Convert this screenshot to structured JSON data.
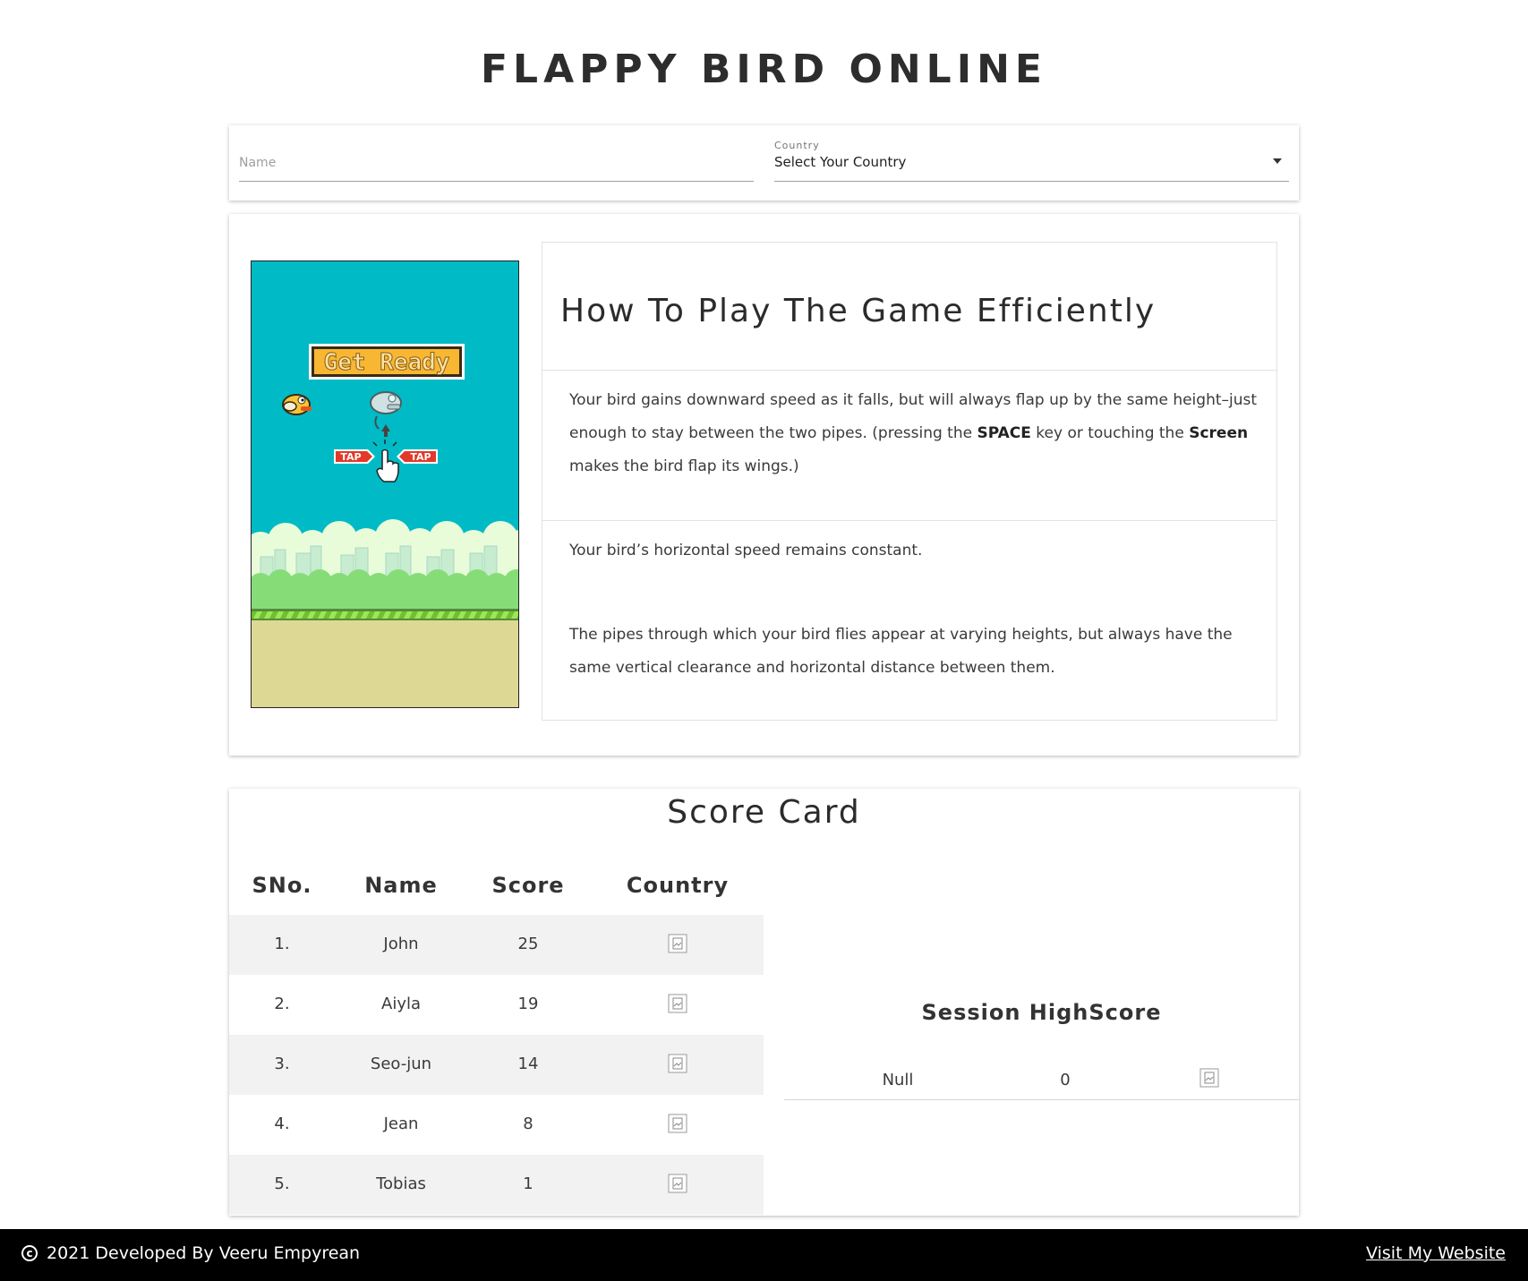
{
  "page": {
    "title": "FLAPPY BIRD ONLINE"
  },
  "form": {
    "name_placeholder": "Name",
    "country_label": "Country",
    "country_value": "Select Your Country"
  },
  "game": {
    "get_ready_text": "Get Ready",
    "tap_left": "TAP",
    "tap_right": "TAP"
  },
  "howto": {
    "heading": "How To Play The Game Efficiently",
    "p1_a": "Your bird gains downward speed as it falls, but will always flap up by the same height–just enough to stay between the two pipes. (pressing the ",
    "p1_key": "SPACE",
    "p1_b": " key or touching the ",
    "p1_screen": "Screen",
    "p1_c": " makes the bird flap its wings.)",
    "p2": "Your bird’s horizontal speed remains constant.",
    "p3": "The pipes through which your bird flies appear at varying heights, but always have the same vertical clearance and horizontal distance between them."
  },
  "scorecard": {
    "title": "Score Card",
    "headers": [
      "SNo.",
      "Name",
      "Score",
      "Country"
    ],
    "rows": [
      {
        "sno": "1.",
        "name": "John",
        "score": "25",
        "country_icon": "broken-image-icon"
      },
      {
        "sno": "2.",
        "name": "Aiyla",
        "score": "19",
        "country_icon": "broken-image-icon"
      },
      {
        "sno": "3.",
        "name": "Seo-jun",
        "score": "14",
        "country_icon": "broken-image-icon"
      },
      {
        "sno": "4.",
        "name": "Jean",
        "score": "8",
        "country_icon": "broken-image-icon"
      },
      {
        "sno": "5.",
        "name": "Tobias",
        "score": "1",
        "country_icon": "broken-image-icon"
      }
    ],
    "session": {
      "title": "Session HighScore",
      "name": "Null",
      "score": "0",
      "country_icon": "broken-image-icon"
    }
  },
  "footer": {
    "copyright_symbol": "c",
    "text": "2021 Developed By Veeru Empyrean",
    "link": "Visit My Website"
  },
  "colors": {
    "sky": "#00bbc5",
    "ground": "#ddd995",
    "footer_bg": "#000000",
    "row_alt": "#f2f2f2"
  }
}
